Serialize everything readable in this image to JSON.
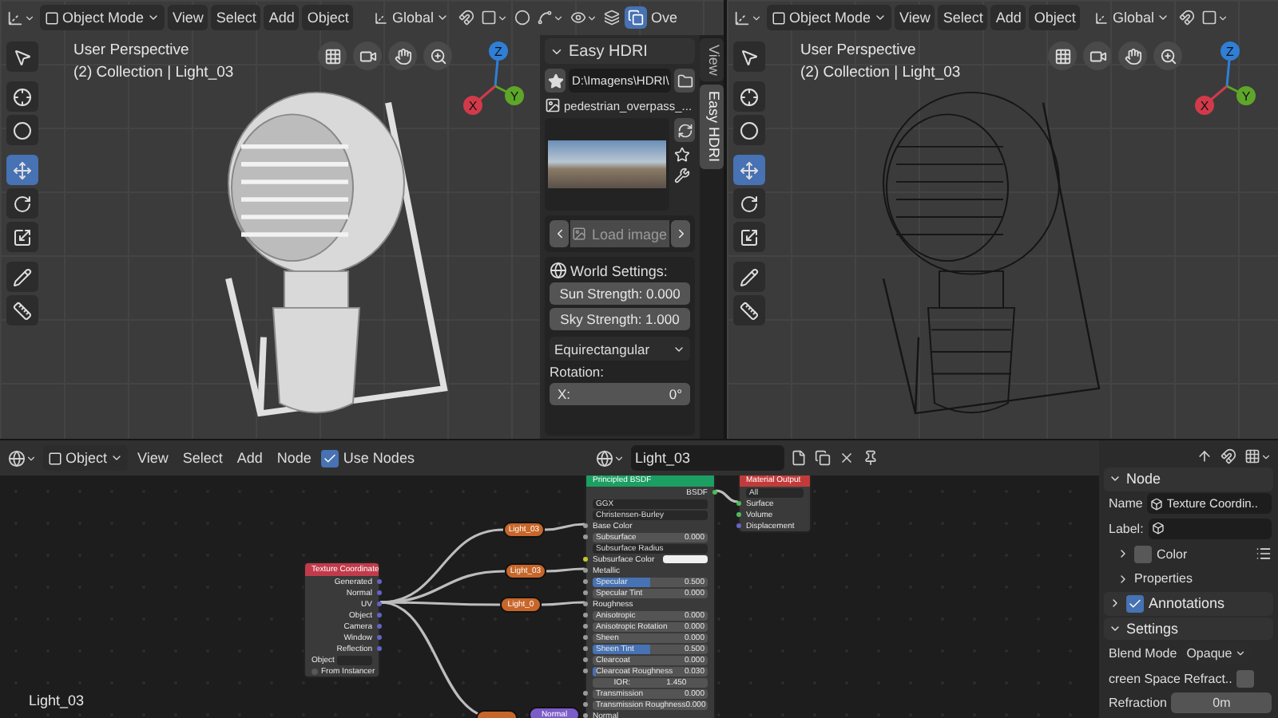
{
  "viewports": [
    {
      "kind": "solid",
      "header": {
        "mode": "Object Mode",
        "menus": [
          "View",
          "Select",
          "Add",
          "Object"
        ],
        "orientation": "Global",
        "overlays": "Ove"
      },
      "info": [
        "User Perspective",
        "(2) Collection | Light_03"
      ],
      "tools": [
        {
          "kind": "select",
          "selected": false
        },
        {
          "kind": "cursor",
          "selected": false
        },
        {
          "kind": "circle",
          "selected": false
        },
        {
          "kind": "move",
          "selected": true
        },
        {
          "kind": "rotate",
          "selected": false
        },
        {
          "kind": "scale",
          "selected": false
        },
        {
          "kind": "annotate",
          "selected": false
        },
        {
          "kind": "measure",
          "selected": false
        }
      ],
      "axes": [
        {
          "label": "Z",
          "color": "#2f7fd6"
        },
        {
          "label": "Y",
          "color": "#5ea62a"
        },
        {
          "label": "X",
          "color": "#d23a4a"
        }
      ]
    },
    {
      "kind": "wireframe",
      "header": {
        "mode": "Object Mode",
        "menus": [
          "View",
          "Select",
          "Add",
          "Object"
        ],
        "orientation": "Global"
      },
      "info": [
        "User Perspective",
        "(2) Collection | Light_03"
      ],
      "tools": [
        {
          "kind": "select",
          "selected": false
        },
        {
          "kind": "cursor",
          "selected": false
        },
        {
          "kind": "circle",
          "selected": false
        },
        {
          "kind": "move",
          "selected": true
        },
        {
          "kind": "rotate",
          "selected": false
        },
        {
          "kind": "scale",
          "selected": false
        },
        {
          "kind": "annotate",
          "selected": false
        },
        {
          "kind": "measure",
          "selected": false
        }
      ],
      "axes": [
        {
          "label": "Z",
          "color": "#2f7fd6"
        },
        {
          "label": "Y",
          "color": "#5ea62a"
        },
        {
          "label": "X",
          "color": "#d23a4a"
        }
      ]
    }
  ],
  "hdri_panel": {
    "title": "Easy HDRI",
    "path": "D:\\Imagens\\HDRI\\",
    "file": "pedestrian_overpass_...",
    "load_button": "Load image",
    "world_title": "World Settings:",
    "sun_strength": "Sun Strength: 0.000",
    "sky_strength": "Sky Strength: 1.000",
    "projection": "Equirectangular",
    "rotation_label": "Rotation:",
    "rotation_x": {
      "label": "X:",
      "value": "0°"
    }
  },
  "sidebar_tabs": [
    {
      "label": "View",
      "selected": false
    },
    {
      "label": "Easy HDRI",
      "selected": true
    }
  ],
  "node_editor": {
    "header": {
      "mode": "Object",
      "menus": [
        "View",
        "Select",
        "Add",
        "Node"
      ],
      "use_nodes": {
        "label": "Use Nodes",
        "checked": true
      },
      "material": "Light_03"
    },
    "object_label": "Light_03",
    "texture_coordinate": {
      "title": "Texture Coordinate",
      "outputs": [
        "Generated",
        "Normal",
        "UV",
        "Object",
        "Camera",
        "Window",
        "Reflection"
      ],
      "object_label": "Object",
      "from_instancer": {
        "label": "From Instancer",
        "checked": false
      }
    },
    "pills": [
      {
        "label": "Light_03",
        "color": "#c8662a"
      },
      {
        "label": "Light_03",
        "color": "#c8662a"
      },
      {
        "label": "Light_0",
        "color": "#c8662a"
      },
      {
        "color": "#c8662a"
      },
      {
        "label": "Normal",
        "color": "#7c5cc8"
      }
    ],
    "principled": {
      "title": "Principled BSDF",
      "output": "BSDF",
      "rows": [
        {
          "kind": "dropdown",
          "label": "GGX"
        },
        {
          "kind": "dropdown",
          "label": "Christensen-Burley"
        },
        {
          "kind": "socket",
          "label": "Base Color"
        },
        {
          "kind": "value",
          "label": "Subsurface",
          "value": "0.000",
          "level": 0
        },
        {
          "kind": "dropdown",
          "label": "Subsurface Radius"
        },
        {
          "kind": "color",
          "label": "Subsurface Color"
        },
        {
          "kind": "socket",
          "label": "Metallic"
        },
        {
          "kind": "value",
          "label": "Specular",
          "value": "0.500",
          "level": 0.5
        },
        {
          "kind": "value",
          "label": "Specular Tint",
          "value": "0.000",
          "level": 0
        },
        {
          "kind": "socket",
          "label": "Roughness"
        },
        {
          "kind": "value",
          "label": "Anisotropic",
          "value": "0.000",
          "level": 0
        },
        {
          "kind": "value",
          "label": "Anisotropic Rotation",
          "value": "0.000",
          "level": 0
        },
        {
          "kind": "value",
          "label": "Sheen",
          "value": "0.000",
          "level": 0
        },
        {
          "kind": "value",
          "label": "Sheen Tint",
          "value": "0.500",
          "level": 0.5
        },
        {
          "kind": "value",
          "label": "Clearcoat",
          "value": "0.000",
          "level": 0
        },
        {
          "kind": "value",
          "label": "Clearcoat Roughness",
          "value": "0.030",
          "level": 0.03
        },
        {
          "kind": "number",
          "label": "IOR:",
          "value": "1.450"
        },
        {
          "kind": "value",
          "label": "Transmission",
          "value": "0.000",
          "level": 0
        },
        {
          "kind": "value",
          "label": "Transmission Roughness",
          "value": "0.000",
          "level": 0
        },
        {
          "kind": "socket",
          "label": "Normal"
        }
      ]
    },
    "material_output": {
      "title": "Material Output",
      "target": "All",
      "inputs": [
        "Surface",
        "Volume",
        "Displacement"
      ]
    }
  },
  "properties": {
    "node": {
      "title": "Node",
      "expanded": true,
      "name_label": "Name",
      "name_value": "Texture Coordin..",
      "label_label": "Label:"
    },
    "color": {
      "label": "Color",
      "checked": false,
      "expanded": false
    },
    "node_properties": {
      "label": "Properties",
      "expanded": false
    },
    "annotations": {
      "label": "Annotations",
      "checked": true,
      "expanded": false
    },
    "settings": {
      "title": "Settings",
      "expanded": true,
      "blend_mode_label": "Blend Mode",
      "blend_mode": "Opaque",
      "refract_label": "creen Space Refract..",
      "refract_checked": false,
      "refraction_label": "Refraction",
      "refraction_value": "0m"
    }
  }
}
